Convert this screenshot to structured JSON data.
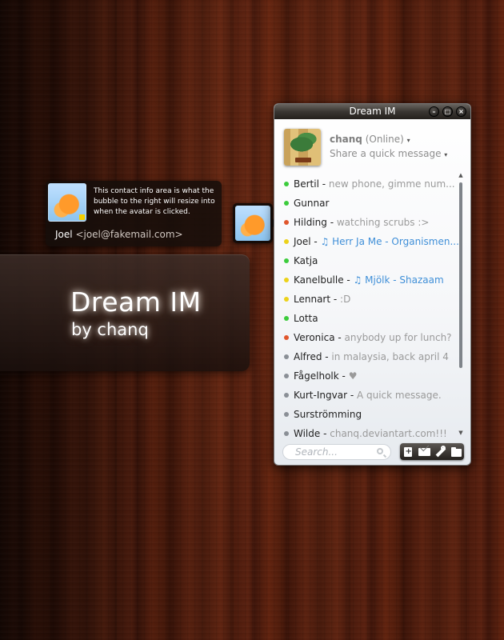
{
  "brand": {
    "title": "Dream IM",
    "subtitle": "by chanq"
  },
  "contact_info": {
    "description": "This contact info area is what the bubble to the right will resize into when the avatar is clicked.",
    "name": "Joel",
    "email": "<joel@fakemail.com>"
  },
  "window": {
    "title": "Dream IM",
    "buttons": {
      "minimize": "–",
      "maximize": "□",
      "close": "×"
    }
  },
  "profile": {
    "name": "chanq",
    "status": "(Online)",
    "message": "Share a quick message",
    "caret": "▾"
  },
  "contacts": [
    {
      "name": "Bertil ",
      "sep": " - ",
      "status": "new phone, gimme num...",
      "status_type": "text",
      "status_color": "#3ccc3c"
    },
    {
      "name": "Gunnar",
      "sep": "",
      "status": "",
      "status_type": "text",
      "status_color": "#3ccc3c"
    },
    {
      "name": "Hilding",
      "sep": " - ",
      "status": "watching scrubs :>",
      "status_type": "text",
      "status_color": "#e0562c"
    },
    {
      "name": "Joel",
      "sep": " - ",
      "status": "♫ Herr Ja Me - Organismen...",
      "status_type": "music",
      "status_color": "#ecd21a"
    },
    {
      "name": "Katja",
      "sep": "",
      "status": "",
      "status_type": "text",
      "status_color": "#3ccc3c"
    },
    {
      "name": "Kanelbulle",
      "sep": " - ",
      "status": "♫ Mjölk - Shazaam",
      "status_type": "music",
      "status_color": "#ecd21a"
    },
    {
      "name": "Lennart",
      "sep": " - ",
      "status": ":D",
      "status_type": "text",
      "status_color": "#ecd21a"
    },
    {
      "name": "Lotta",
      "sep": "",
      "status": "",
      "status_type": "text",
      "status_color": "#3ccc3c"
    },
    {
      "name": "Veronica",
      "sep": " - ",
      "status": "anybody up for lunch?",
      "status_type": "text",
      "status_color": "#e0562c"
    },
    {
      "name": "Alfred",
      "sep": " - ",
      "status": "in malaysia, back april 4",
      "status_type": "text",
      "status_color": "#8a8f96"
    },
    {
      "name": "Fågelholk",
      "sep": " - ",
      "status": "♥",
      "status_type": "text",
      "status_color": "#8a8f96"
    },
    {
      "name": "Kurt-Ingvar",
      "sep": " - ",
      "status": "A quick message.",
      "status_type": "text",
      "status_color": "#8a8f96"
    },
    {
      "name": "Surströmming",
      "sep": "",
      "status": "",
      "status_type": "text",
      "status_color": "#8a8f96"
    },
    {
      "name": "Wilde",
      "sep": " - ",
      "status": "chanq.deviantart.com!!!",
      "status_type": "text",
      "status_color": "#8a8f96"
    }
  ],
  "scrollbar": {
    "up": "▲",
    "down": "▼"
  },
  "search": {
    "placeholder": "Search..."
  },
  "toolbar": {
    "icons": [
      "add-contact-icon",
      "mail-icon",
      "wrench-icon",
      "folder-icon"
    ]
  }
}
